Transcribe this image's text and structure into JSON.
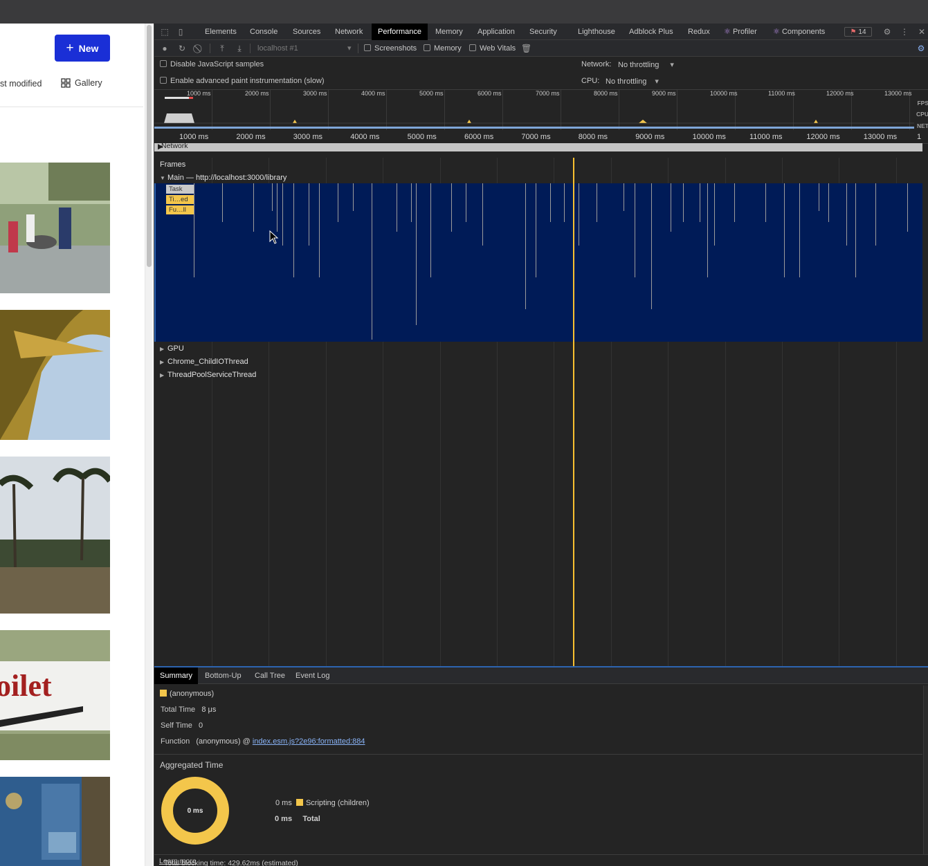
{
  "app": {
    "new_button": "New",
    "sort_label": "st modified",
    "gallery_label": "Gallery"
  },
  "devtools": {
    "tabs": [
      "Elements",
      "Console",
      "Sources",
      "Network",
      "Performance",
      "Memory",
      "Application",
      "Security",
      "Lighthouse",
      "Adblock Plus",
      "Redux",
      "Profiler",
      "Components"
    ],
    "active_tab": "Performance",
    "issues_count": "14"
  },
  "perf_toolbar": {
    "target": "localhost #1",
    "screenshots_label": "Screenshots",
    "memory_label": "Memory",
    "web_vitals_label": "Web Vitals"
  },
  "settings": {
    "disable_js_samples": "Disable JavaScript samples",
    "advanced_paint": "Enable advanced paint instrumentation (slow)",
    "network_label": "Network:",
    "network_value": "No throttling",
    "cpu_label": "CPU:",
    "cpu_value": "No throttling"
  },
  "overview": {
    "ticks": [
      "1000 ms",
      "2000 ms",
      "3000 ms",
      "4000 ms",
      "5000 ms",
      "6000 ms",
      "7000 ms",
      "8000 ms",
      "9000 ms",
      "10000 ms",
      "11000 ms",
      "12000 ms",
      "13000 ms"
    ],
    "side_labels": [
      "FPS",
      "CPU",
      "NET"
    ]
  },
  "ruler": {
    "ticks": [
      "1000 ms",
      "2000 ms",
      "3000 ms",
      "4000 ms",
      "5000 ms",
      "6000 ms",
      "7000 ms",
      "8000 ms",
      "9000 ms",
      "10000 ms",
      "11000 ms",
      "12000 ms",
      "13000 ms",
      "1"
    ]
  },
  "tracks": {
    "network": "Network",
    "frames": "Frames",
    "main": "Main — http://localhost:3000/library",
    "task_box": "Task",
    "timer_box": "Ti…ed",
    "function_box": "Fu…ll",
    "gpu": "GPU",
    "child_io": "Chrome_ChildIOThread",
    "thread_pool": "ThreadPoolServiceThread"
  },
  "bottom_tabs": [
    "Summary",
    "Bottom-Up",
    "Call Tree",
    "Event Log"
  ],
  "summary": {
    "title": "(anonymous)",
    "total_time_label": "Total Time",
    "total_time_value": "8 μs",
    "self_time_label": "Self Time",
    "self_time_value": "0",
    "function_label": "Function",
    "function_value": "(anonymous) @",
    "function_link": "index.esm.js?2e96:formatted:884",
    "aggregated_title": "Aggregated Time",
    "donut_center": "0 ms",
    "legend": [
      {
        "value": "0 ms",
        "label": "Scripting (children)"
      },
      {
        "value": "0 ms",
        "label": "Total"
      }
    ],
    "swatch_color": "#f3c64b"
  },
  "footer": {
    "blocking_text": "Total blocking time: 429.62ms (estimated)",
    "learn_more": "Learn more"
  }
}
